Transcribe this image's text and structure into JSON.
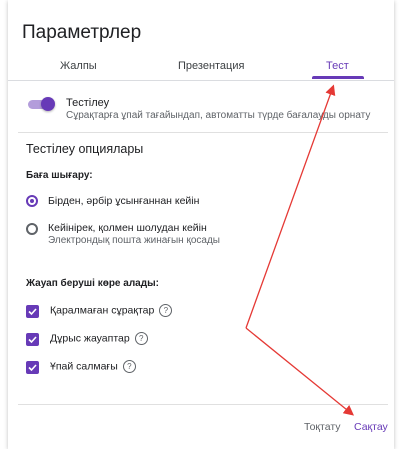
{
  "dialog": {
    "title": "Параметрлер",
    "tabs": [
      {
        "label": "Жалпы"
      },
      {
        "label": "Презентация"
      },
      {
        "label": "Тест",
        "active": true
      }
    ]
  },
  "quiz_toggle": {
    "label": "Тестілеу",
    "description": "Сұрақтарға ұпай тағайындап, автоматты түрде бағалауды орнату",
    "on": true
  },
  "quiz_options": {
    "title": "Тестілеу опциялары",
    "release_grade": {
      "title": "Баға шығару:",
      "options": [
        {
          "label": "Бірден, әрбір ұсынғаннан кейін",
          "selected": true
        },
        {
          "label": "Кейінірек, қолмен шолудан кейін",
          "sublabel": "Электрондық пошта жинағын қосады",
          "selected": false
        }
      ]
    },
    "respondent_can_see": {
      "title": "Жауап беруші көре алады:",
      "options": [
        {
          "label": "Қаралмаған сұрақтар",
          "checked": true
        },
        {
          "label": "Дұрыс жауаптар",
          "checked": true
        },
        {
          "label": "Ұпай салмағы",
          "checked": true
        }
      ]
    }
  },
  "footer": {
    "cancel_label": "Тоқтату",
    "save_label": "Сақтау"
  },
  "colors": {
    "accent": "#673ab7",
    "annotation_arrow": "#e53935"
  },
  "icons": {
    "help": "help-circle-icon",
    "check": "check-icon"
  }
}
